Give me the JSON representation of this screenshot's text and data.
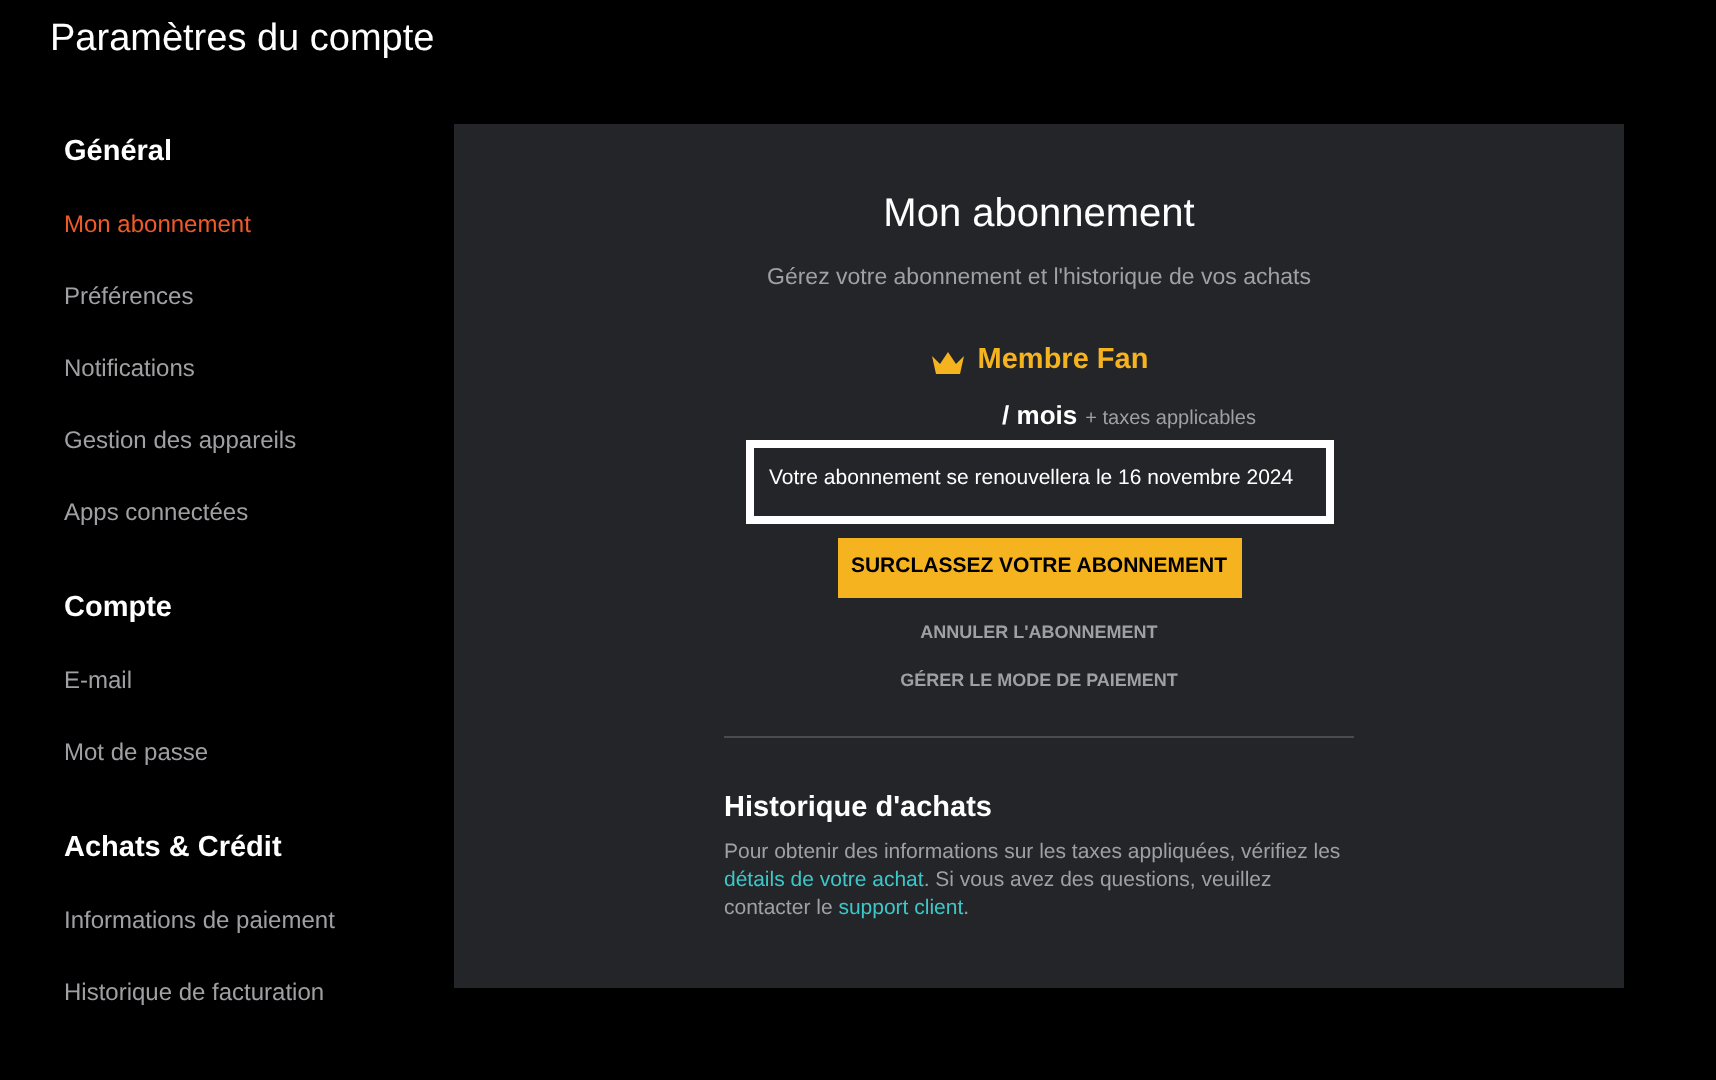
{
  "page_title": "Paramètres du compte",
  "sidebar": [
    {
      "heading": "Général",
      "items": [
        {
          "label": "Mon abonnement",
          "selected": true
        },
        {
          "label": "Préférences",
          "selected": false
        },
        {
          "label": "Notifications",
          "selected": false
        },
        {
          "label": "Gestion des appareils",
          "selected": false
        },
        {
          "label": "Apps connectées",
          "selected": false
        }
      ]
    },
    {
      "heading": "Compte",
      "items": [
        {
          "label": "E-mail",
          "selected": false
        },
        {
          "label": "Mot de passe",
          "selected": false
        }
      ]
    },
    {
      "heading": "Achats & Crédit",
      "items": [
        {
          "label": "Informations de paiement",
          "selected": false
        },
        {
          "label": "Historique de facturation",
          "selected": false
        }
      ]
    }
  ],
  "panel": {
    "title": "Mon abonnement",
    "subtitle": "Gérez votre abonnement et l'historique de vos achats",
    "plan": "Membre Fan",
    "period": "/ mois",
    "taxes": "+ taxes applicables",
    "renewal": "Votre abonnement se renouvellera le 16 novembre 2024",
    "upgrade_button": "SURCLASSEZ VOTRE ABONNEMENT",
    "links": [
      "ANNULER L'ABONNEMENT",
      "GÉRER LE MODE DE PAIEMENT"
    ],
    "history": {
      "title": "Historique d'achats",
      "text": [
        {
          "kind": "text",
          "text": "Pour obtenir des informations sur les taxes appliquées, vérifiez les "
        },
        {
          "kind": "link",
          "text": "détails de votre achat"
        },
        {
          "kind": "text",
          "text": ". Si vous avez des questions, veuillez contacter le "
        },
        {
          "kind": "link",
          "text": "support client"
        },
        {
          "kind": "text",
          "text": "."
        }
      ]
    }
  }
}
